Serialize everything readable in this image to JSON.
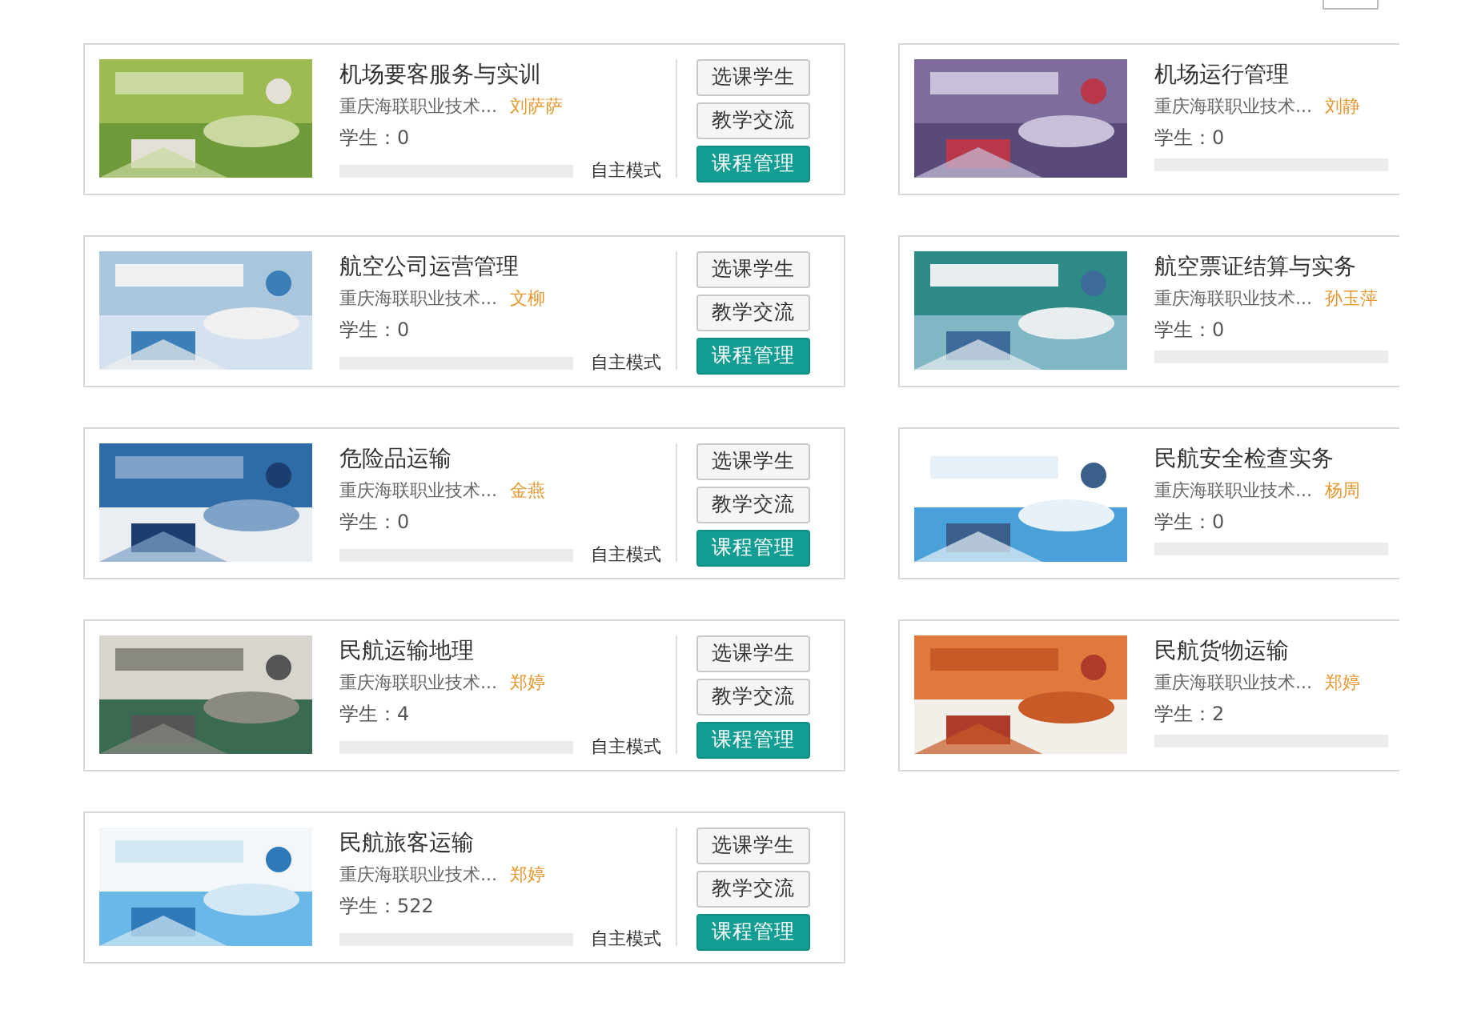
{
  "courses": [
    {
      "title": "机场要客服务与实训",
      "school": "重庆海联职业技术...",
      "teacher": "刘萨萨",
      "students": "学生：0",
      "level": 0,
      "mode": "自主模式",
      "buttons": [
        {
          "label": "选课学生",
          "kind": "plain"
        },
        {
          "label": "教学交流",
          "kind": "plain"
        },
        {
          "label": "课程管理",
          "kind": "primary"
        }
      ]
    },
    {
      "title": "机场运行管理",
      "school": "重庆海联职业技术...",
      "teacher": "刘静",
      "students": "学生：0",
      "level": 0
    },
    {
      "title": "航空公司运营管理",
      "school": "重庆海联职业技术...",
      "teacher": "文柳",
      "students": "学生：0",
      "level": 0,
      "mode": "自主模式",
      "buttons": [
        {
          "label": "选课学生",
          "kind": "plain"
        },
        {
          "label": "教学交流",
          "kind": "plain"
        },
        {
          "label": "课程管理",
          "kind": "primary"
        }
      ]
    },
    {
      "title": "航空票证结算与实务",
      "school": "重庆海联职业技术...",
      "teacher": "孙玉萍",
      "students": "学生：0",
      "level": 0
    },
    {
      "title": "危险品运输",
      "school": "重庆海联职业技术...",
      "teacher": "金燕",
      "students": "学生：0",
      "level": 0,
      "mode": "自主模式",
      "buttons": [
        {
          "label": "选课学生",
          "kind": "plain"
        },
        {
          "label": "教学交流",
          "kind": "plain"
        },
        {
          "label": "课程管理",
          "kind": "primary"
        }
      ]
    },
    {
      "title": "民航安全检查实务",
      "school": "重庆海联职业技术...",
      "teacher": "杨周",
      "students": "学生：0",
      "level": 0
    },
    {
      "title": "民航运输地理",
      "school": "重庆海联职业技术...",
      "teacher": "郑婷",
      "students": "学生：4",
      "level": 0,
      "mode": "自主模式",
      "buttons": [
        {
          "label": "选课学生",
          "kind": "plain"
        },
        {
          "label": "教学交流",
          "kind": "plain"
        },
        {
          "label": "课程管理",
          "kind": "primary"
        }
      ]
    },
    {
      "title": "民航货物运输",
      "school": "重庆海联职业技术...",
      "teacher": "郑婷",
      "students": "学生：2",
      "level": 0
    },
    {
      "title": "民航旅客运输",
      "school": "重庆海联职业技术...",
      "teacher": "郑婷",
      "students": "学生：522",
      "level": 0,
      "mode": "自主模式",
      "buttons": [
        {
          "label": "选课学生",
          "kind": "plain"
        },
        {
          "label": "教学交流",
          "kind": "plain"
        },
        {
          "label": "课程管理",
          "kind": "primary"
        }
      ]
    }
  ]
}
